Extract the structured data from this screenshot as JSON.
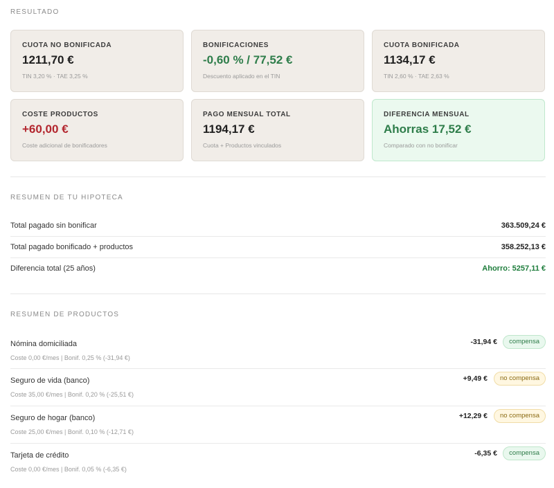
{
  "result": {
    "title": "RESULTADO",
    "cards": [
      {
        "label": "CUOTA NO BONIFICADA",
        "value": "1211,70 €",
        "sub": "TIN 3,20 % · TAE 3,25 %"
      },
      {
        "label": "BONIFICACIONES",
        "value": "-0,60 % / 77,52 €",
        "sub": "Descuento aplicado en el TIN"
      },
      {
        "label": "CUOTA BONIFICADA",
        "value": "1134,17 €",
        "sub": "TIN 2,60 % · TAE 2,63 %"
      },
      {
        "label": "COSTE PRODUCTOS",
        "value": "+60,00 €",
        "sub": "Coste adicional de bonificadores"
      },
      {
        "label": "PAGO MENSUAL TOTAL",
        "value": "1194,17 €",
        "sub": "Cuota + Productos vinculados"
      },
      {
        "label": "DIFERENCIA MENSUAL",
        "value": "Ahorras 17,52 €",
        "sub": "Comparado con no bonificar"
      }
    ]
  },
  "summary": {
    "title": "RESUMEN DE TU HIPOTECA",
    "rows": [
      {
        "label": "Total pagado sin bonificar",
        "value": "363.509,24 €"
      },
      {
        "label": "Total pagado bonificado + productos",
        "value": "358.252,13 €"
      },
      {
        "label": "Diferencia total (25 años)",
        "value": "Ahorro: 5257,11 €"
      }
    ]
  },
  "products": {
    "title": "RESUMEN DE PRODUCTOS",
    "items": [
      {
        "name": "Nómina domiciliada",
        "meta": "Coste 0,00 €/mes | Bonif. 0,25 % (-31,94 €)",
        "amount": "-31,94 €",
        "badge": "compensa"
      },
      {
        "name": "Seguro de vida (banco)",
        "meta": "Coste 35,00 €/mes | Bonif. 0,20 % (-25,51 €)",
        "amount": "+9,49 €",
        "badge": "no compensa"
      },
      {
        "name": "Seguro de hogar (banco)",
        "meta": "Coste 25,00 €/mes | Bonif. 0,10 % (-12,71 €)",
        "amount": "+12,29 €",
        "badge": "no compensa"
      },
      {
        "name": "Tarjeta de crédito",
        "meta": "Coste 0,00 €/mes | Bonif. 0,05 % (-6,35 €)",
        "amount": "-6,35 €",
        "badge": "compensa"
      }
    ]
  },
  "colors": {
    "positive": "#2e7d4a",
    "negative": "#b3262e",
    "card_bg": "#f1ede8",
    "card_highlight_bg": "#ebf9ef",
    "badge_ok": "#e9f8ee",
    "badge_no": "#fff7e1"
  }
}
